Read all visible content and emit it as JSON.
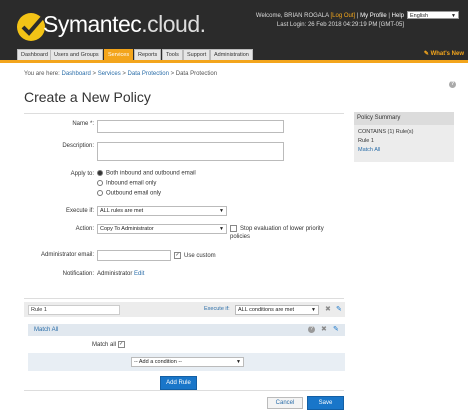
{
  "header": {
    "brand": "Symantec",
    "brand_suffix": ".cloud.",
    "welcome_prefix": "Welcome, BRIAN ROGALA",
    "logout": "[Log Out]",
    "my_profile": "My Profile",
    "help": "Help",
    "last_login": "Last Login: 26 Feb 2018 04:29:19 PM [GMT-05]",
    "language": "English",
    "whats_new": "What's New"
  },
  "nav": {
    "tabs": [
      "Dashboard",
      "Users and Groups",
      "Services",
      "Reports",
      "Tools",
      "Support",
      "Administration"
    ],
    "active": "Services"
  },
  "breadcrumb": {
    "prefix": "You are here:",
    "dashboard": "Dashboard",
    "services": "Services",
    "data_protection": "Data Protection",
    "current": "Data Protection"
  },
  "page_title": "Create a New Policy",
  "form": {
    "name_label": "Name *:",
    "name_value": "",
    "description_label": "Description:",
    "description_value": "",
    "apply_label": "Apply to:",
    "apply_options": [
      "Both inbound and outbound email",
      "Inbound email only",
      "Outbound email only"
    ],
    "apply_selected": 0,
    "execute_label": "Execute if:",
    "execute_value": "ALL rules are met",
    "action_label": "Action:",
    "action_value": "Copy To Administrator",
    "stop_eval_label": "Stop evaluation of lower priority policies",
    "admin_email_label": "Administrator email:",
    "admin_email_value": "",
    "use_custom_label": "Use custom",
    "notification_label": "Notification:",
    "notification_value": "Administrator",
    "notification_edit": "Edit"
  },
  "summary": {
    "title": "Policy Summary",
    "contains": "CONTAINS (1) Rule(s)",
    "rule": "Rule 1",
    "match": "Match All"
  },
  "rule": {
    "name": "Rule 1",
    "execute_label": "Execute if:",
    "execute_value": "ALL conditions are met",
    "match_title": "Match All",
    "match_all_label": "Match all",
    "add_condition": "-- Add a condition --",
    "add_rule": "Add Rule"
  },
  "buttons": {
    "cancel": "Cancel",
    "save": "Save"
  },
  "colors": {
    "accent": "#f3a51c",
    "link": "#2a6da8",
    "primary_button": "#1976c9"
  }
}
